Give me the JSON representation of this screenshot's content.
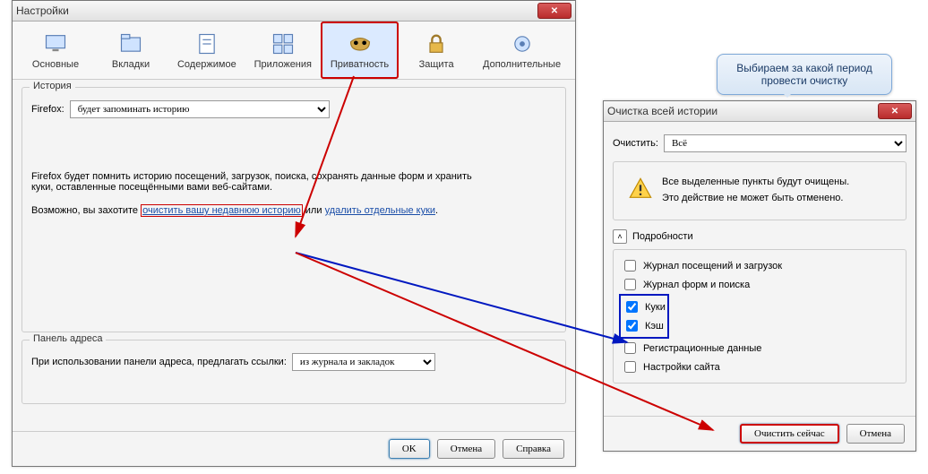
{
  "settings": {
    "title": "Настройки",
    "tabs": [
      {
        "label": "Основные",
        "icon": "monitor"
      },
      {
        "label": "Вкладки",
        "icon": "folder"
      },
      {
        "label": "Содержимое",
        "icon": "page"
      },
      {
        "label": "Приложения",
        "icon": "grid"
      },
      {
        "label": "Приватность",
        "icon": "mask"
      },
      {
        "label": "Защита",
        "icon": "lock"
      },
      {
        "label": "Дополнительные",
        "icon": "gear"
      }
    ],
    "history_group": "История",
    "firefox_label": "Firefox:",
    "firefox_mode": "будет запоминать историю",
    "desc_line1": "Firefox будет помнить историю посещений, загрузок, поиска, сохранять данные форм и хранить",
    "desc_line2": "куки, оставленные посещёнными вами веб-сайтами.",
    "maybe_prefix": "Возможно, вы захотите ",
    "clear_history_link": "очистить вашу недавнюю историю",
    "or_word": " или ",
    "delete_cookies_link": "удалить отдельные куки",
    "period": ".",
    "addressbar_group": "Панель адреса",
    "addressbar_label": "При использовании панели адреса, предлагать ссылки:",
    "addressbar_value": "из журнала и закладок",
    "ok": "OK",
    "cancel": "Отмена",
    "help": "Справка"
  },
  "clear_dialog": {
    "title": "Очистка всей истории",
    "clear_label": "Очистить:",
    "period_value": "Всё",
    "warn1": "Все выделенные пункты будут очищены.",
    "warn2": "Это действие не может быть отменено.",
    "details": "Подробности",
    "items": [
      {
        "label": "Журнал посещений и загрузок",
        "checked": false
      },
      {
        "label": "Журнал форм и поиска",
        "checked": false
      },
      {
        "label": "Куки",
        "checked": true
      },
      {
        "label": "Кэш",
        "checked": true
      },
      {
        "label": "Регистрационные данные",
        "checked": false
      },
      {
        "label": "Настройки сайта",
        "checked": false
      }
    ],
    "clear_now": "Очистить сейчас",
    "cancel": "Отмена"
  },
  "callout": {
    "text": "Выбираем за какой период провести очистку"
  }
}
